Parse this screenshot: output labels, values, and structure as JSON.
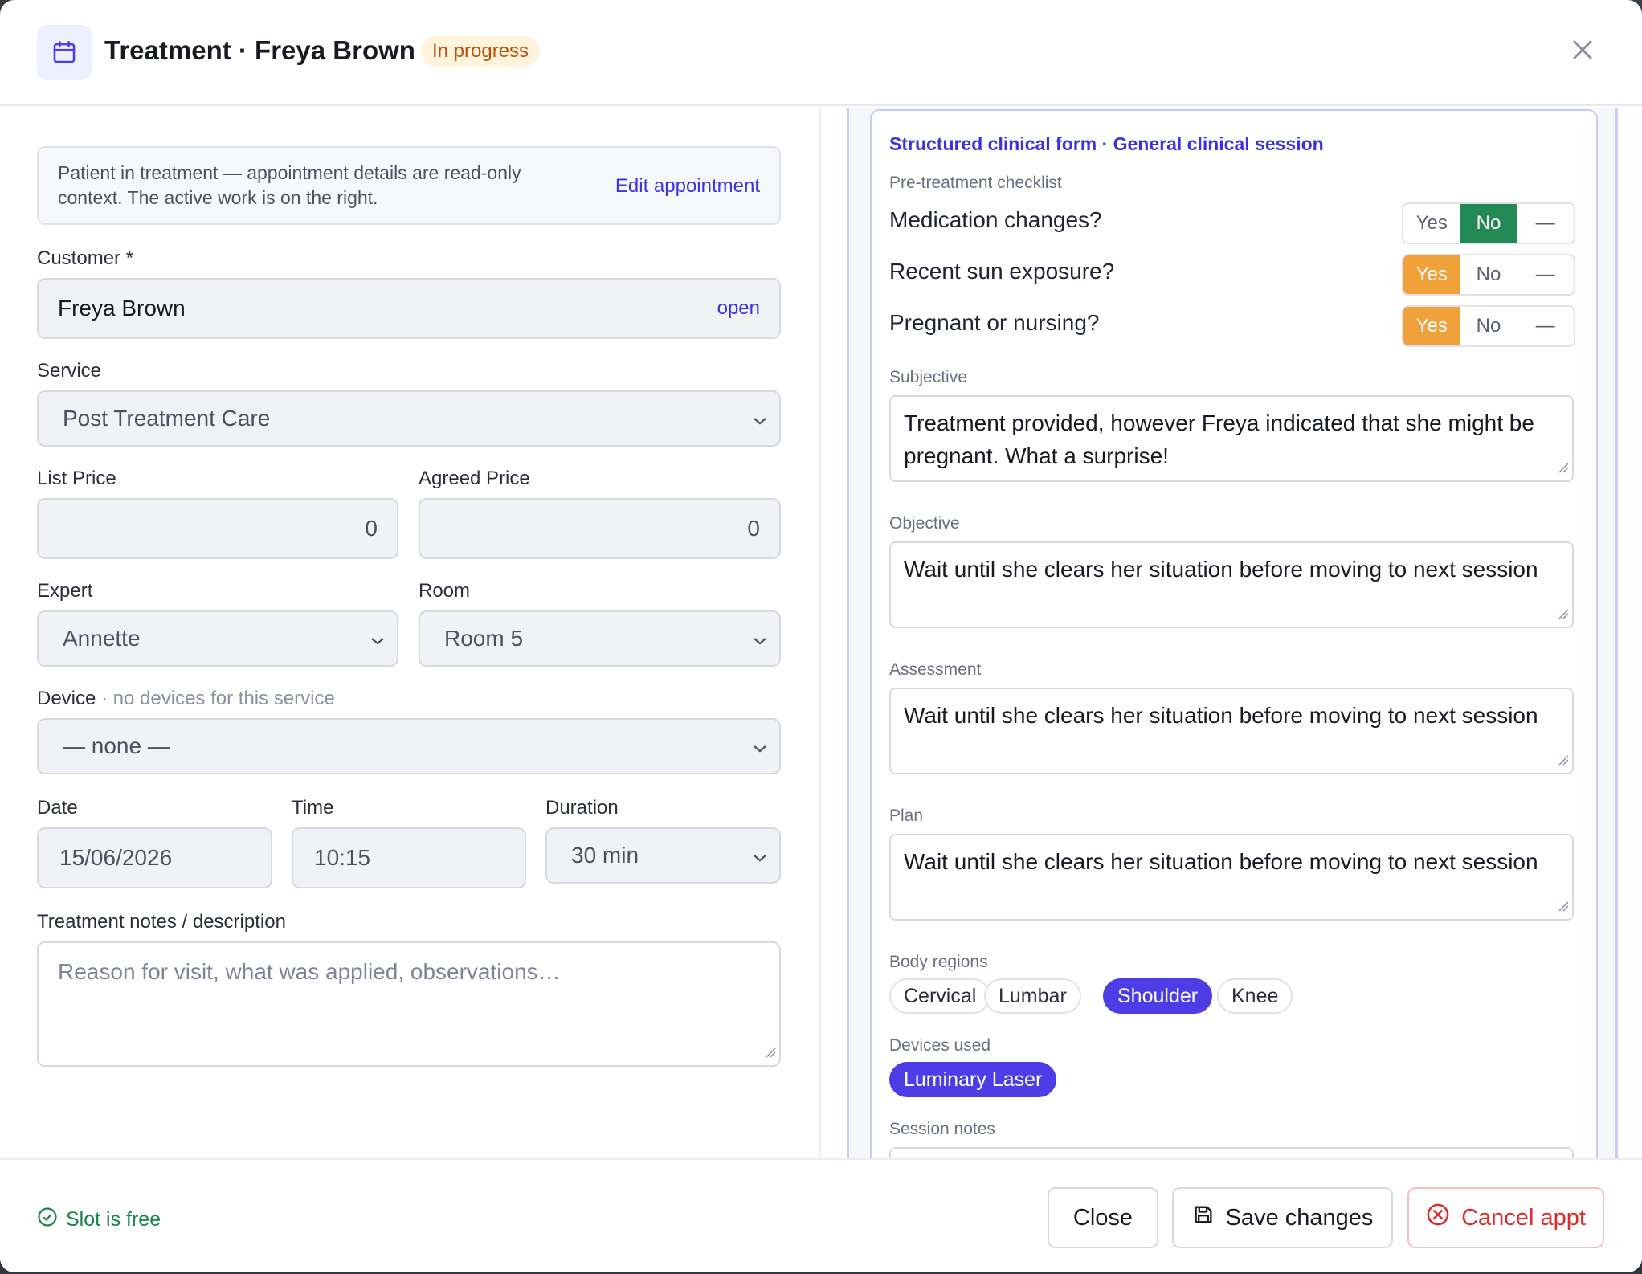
{
  "header": {
    "title": "Treatment · Freya Brown",
    "status": "In progress",
    "calendar_icon": "calendar-icon",
    "close_icon": "close-icon"
  },
  "left": {
    "info_text": "Patient in treatment — appointment details are read-only context. The active work is on the right.",
    "edit_link": "Edit appointment",
    "customer": {
      "label": "Customer *",
      "value": "Freya Brown",
      "link": "open"
    },
    "service": {
      "label": "Service",
      "value": "Post Treatment Care"
    },
    "list_price": {
      "label": "List Price",
      "value": "0"
    },
    "agreed_price": {
      "label": "Agreed Price",
      "value": "0"
    },
    "expert": {
      "label": "Expert",
      "value": "Annette"
    },
    "room": {
      "label": "Room",
      "value": "Room 5"
    },
    "device": {
      "label": "Device",
      "note": "· no devices for this service",
      "value": "— none —"
    },
    "date": {
      "label": "Date",
      "value": "15/06/2026"
    },
    "time": {
      "label": "Time",
      "value": "10:15"
    },
    "duration": {
      "label": "Duration",
      "value": "30 min"
    },
    "notes": {
      "label": "Treatment notes / description",
      "placeholder": "Reason for visit, what was applied, observations…"
    }
  },
  "form": {
    "title": "Structured clinical form · General clinical session",
    "checklist_label": "Pre-treatment checklist",
    "questions": [
      {
        "text": "Medication changes?",
        "selected": "No"
      },
      {
        "text": "Recent sun exposure?",
        "selected": "Yes"
      },
      {
        "text": "Pregnant or nursing?",
        "selected": "Yes"
      }
    ],
    "options": [
      "Yes",
      "No",
      "—"
    ],
    "subjective": {
      "label": "Subjective",
      "value": "Treatment provided, however Freya indicated that she might be pregnant. What a surprise!"
    },
    "objective": {
      "label": "Objective",
      "value": "Wait until she clears her situation before moving to next session"
    },
    "assessment": {
      "label": "Assessment",
      "value": "Wait until she clears her situation before moving to next session"
    },
    "plan": {
      "label": "Plan",
      "value": "Wait until she clears her situation before moving to next session"
    },
    "body_regions_label": "Body regions",
    "body_regions": [
      {
        "label": "Cervical",
        "selected": false
      },
      {
        "label": "Lumbar",
        "selected": false
      },
      {
        "label": "Shoulder",
        "selected": true
      },
      {
        "label": "Knee",
        "selected": false
      }
    ],
    "devices_label": "Devices used",
    "devices": [
      {
        "label": "Luminary Laser",
        "selected": true
      }
    ],
    "session_notes_label": "Session notes"
  },
  "footer": {
    "slot_status": "Slot is free",
    "close": "Close",
    "save": "Save changes",
    "cancel": "Cancel appt"
  },
  "colors": {
    "accent": "#3b32e0",
    "chip_selected": "#4d3de6",
    "yes_on": "#f1a13a",
    "no_on": "#238a55",
    "success": "#16844a",
    "danger": "#d92d2d",
    "badge_bg": "#fff3dc",
    "badge_text": "#b45309"
  }
}
